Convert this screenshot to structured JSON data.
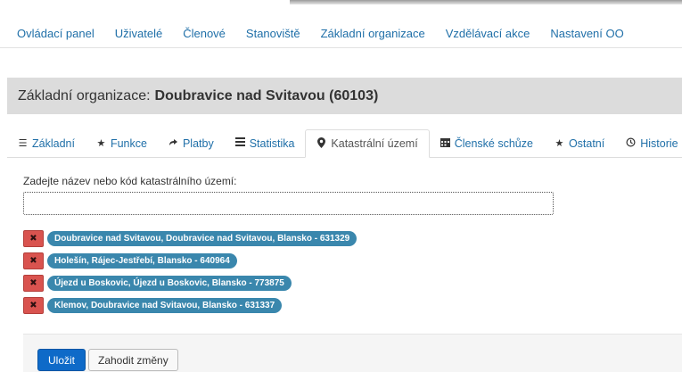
{
  "main_nav": [
    {
      "label": "Ovládací panel"
    },
    {
      "label": "Uživatelé"
    },
    {
      "label": "Členové"
    },
    {
      "label": "Stanoviště"
    },
    {
      "label": "Základní organizace"
    },
    {
      "label": "Vzdělávací akce"
    },
    {
      "label": "Nastavení OO"
    }
  ],
  "heading": {
    "prefix": "Základní organizace:",
    "name": "Doubravice nad Svitavou (60103)"
  },
  "tabs": [
    {
      "label": "Základní",
      "icon": "list-icon"
    },
    {
      "label": "Funkce",
      "icon": "star-icon"
    },
    {
      "label": "Platby",
      "icon": "share-icon"
    },
    {
      "label": "Statistika",
      "icon": "bars-icon"
    },
    {
      "label": "Katastrální území",
      "icon": "map-marker-icon",
      "active": true
    },
    {
      "label": "Členské schůze",
      "icon": "calendar-icon"
    },
    {
      "label": "Ostatní",
      "icon": "star-icon"
    },
    {
      "label": "Historie",
      "icon": "clock-icon"
    }
  ],
  "form": {
    "label": "Zadejte název nebo kód katastrálního území:",
    "input_value": "",
    "input_placeholder": ""
  },
  "items": [
    {
      "label": "Doubravice nad Svitavou, Doubravice nad Svitavou, Blansko - 631329"
    },
    {
      "label": "Holešín, Rájec-Jestřebí, Blansko - 640964"
    },
    {
      "label": "Újezd u Boskovic, Újezd u Boskovic, Blansko - 773875"
    },
    {
      "label": "Klemov, Doubravice nad Svitavou, Blansko - 631337"
    }
  ],
  "actions": {
    "save_label": "Uložit",
    "discard_label": "Zahodit změny"
  },
  "colors": {
    "link": "#1f6fa8",
    "badge": "#3a87ad",
    "remove": "#d9534f",
    "primary": "#0e6ac8"
  }
}
